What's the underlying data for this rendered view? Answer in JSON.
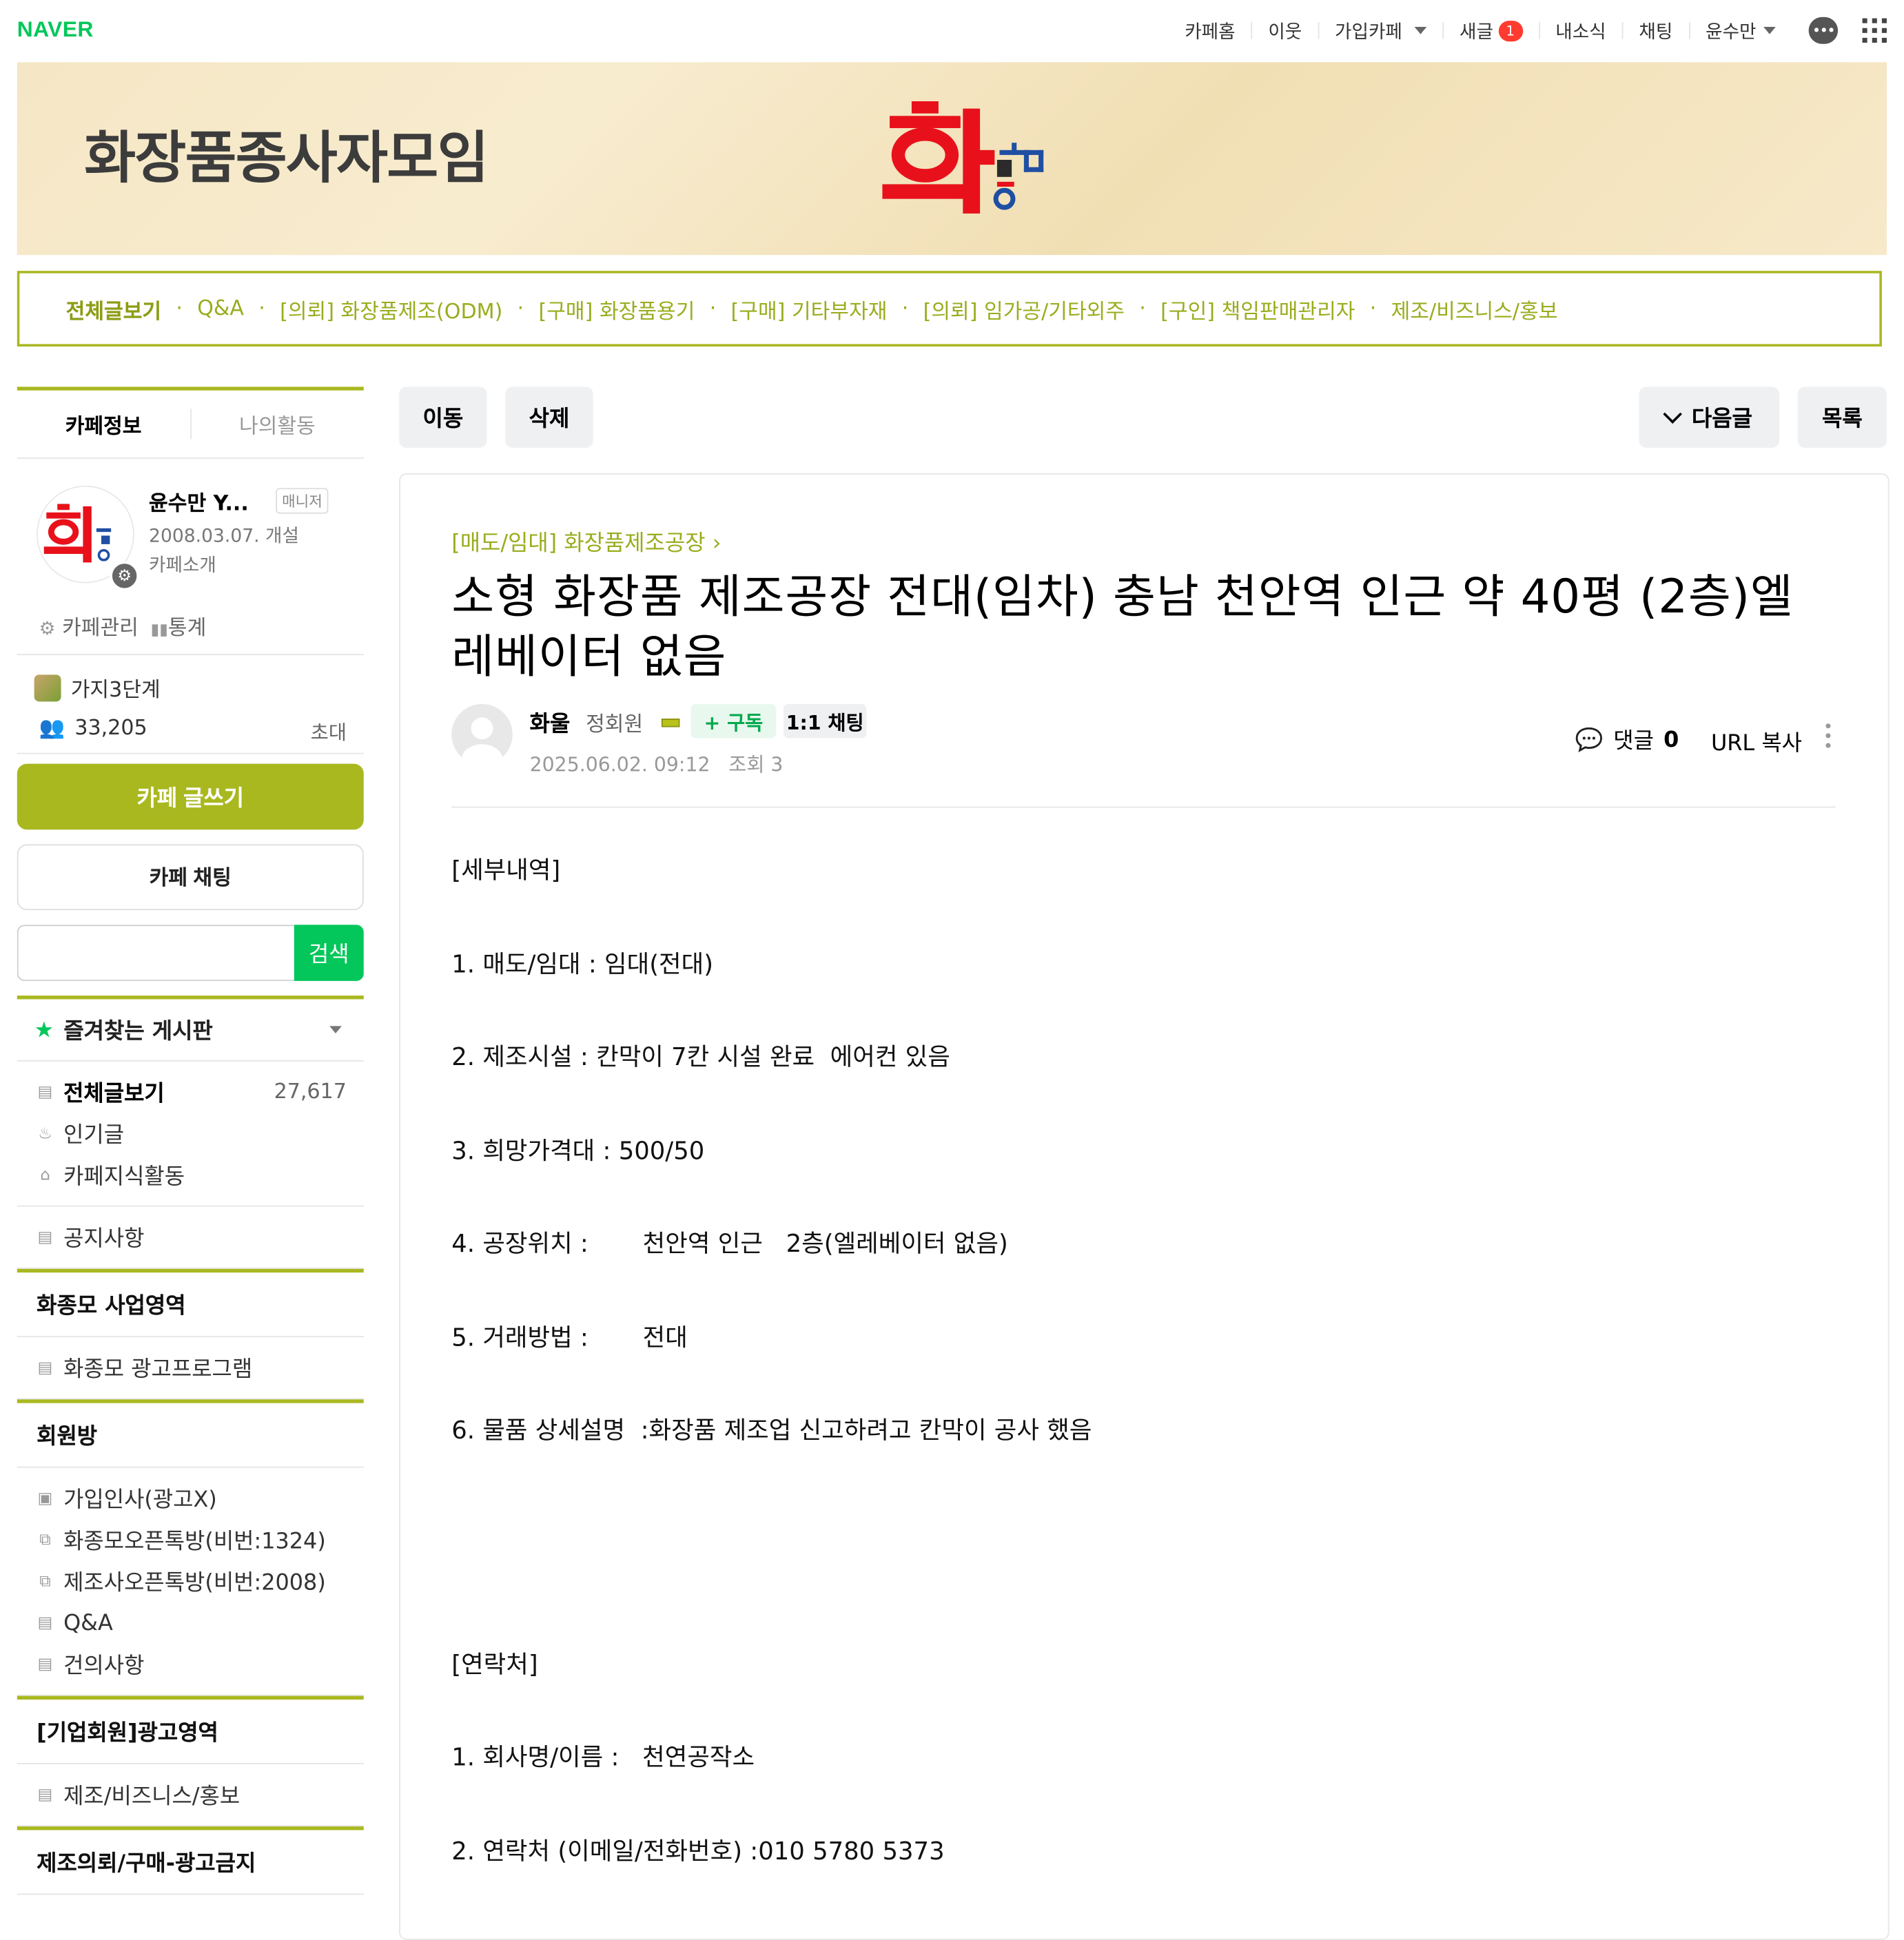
{
  "gnb": {
    "logo": "NAVER",
    "items": [
      "카페홈",
      "이웃",
      "가입카페",
      "새글",
      "내소식",
      "채팅",
      "윤수만"
    ],
    "new_count": "1"
  },
  "banner": {
    "title": "화장품종사자모임"
  },
  "menu": [
    "전체글보기",
    "Q&A",
    "[의뢰] 화장품제조(ODM)",
    "[구매] 화장품용기",
    "[구매] 기타부자재",
    "[의뢰] 임가공/기타외주",
    "[구인] 책임판매관리자",
    "제조/비즈니스/홍보"
  ],
  "sidebar": {
    "tabs": [
      "카페정보",
      "나의활동"
    ],
    "manager_name": "윤수만 Y...",
    "manager_tag": "매니저",
    "open_date": "2008.03.07. 개설",
    "intro": "카페소개",
    "manage": "카페관리",
    "stats": "통계",
    "level": "가지3단계",
    "members": "33,205",
    "invite": "초대",
    "write_btn": "카페 글쓰기",
    "chat_btn": "카페 채팅",
    "search_btn": "검색",
    "fav_title": "즐겨찾는 게시판",
    "boards1": [
      {
        "label": "전체글보기",
        "count": "27,617"
      },
      {
        "label": "인기글"
      },
      {
        "label": "카페지식활동"
      }
    ],
    "notice": "공지사항",
    "sec1": "화종모 사업영역",
    "sec1_items": [
      "화종모 광고프로그램"
    ],
    "sec2": "회원방",
    "sec2_items": [
      "가입인사(광고X)",
      "화종모오픈톡방(비번:1324)",
      "제조사오픈톡방(비번:2008)",
      "Q&A",
      "건의사항"
    ],
    "sec3": "[기업회원]광고영역",
    "sec3_items": [
      "제조/비즈니스/홍보"
    ],
    "sec4": "제조의뢰/구매-광고금지"
  },
  "toolbar": {
    "move": "이동",
    "delete": "삭제",
    "next": "다음글",
    "list": "목록"
  },
  "article": {
    "board": "[매도/임대] 화장품제조공장",
    "title": "소형 화장품 제조공장 전대(임차) 충남 천안역 인근 약 40평 (2층)엘레베이터 없음",
    "author": "화울",
    "grade": "정회원",
    "subscribe": "+ 구독",
    "chat": "1:1 채팅",
    "date": "2025.06.02. 09:12",
    "views": "조회 3",
    "comments_label": "댓글",
    "comments_count": "0",
    "url_copy": "URL 복사",
    "lines": [
      "[세부내역]",
      "1. 매도/임대 : 임대(전대)",
      "2. 제조시설 : 칸막이 7칸 시설 완료  에어컨 있음",
      "3. 희망가격대 : 500/50",
      "4. 공장위치 :       천안역 인근   2층(엘레베이터 없음)",
      "5. 거래방법 :       전대",
      "6. 물품 상세설명  :화장품 제조업 신고하려고 칸막이 공사 했음",
      "[연락처]",
      "1. 회사명/이름 :   천연공작소",
      "2. 연락처 (이메일/전화번호) :010 5780 5373"
    ]
  },
  "colors": {
    "brand": "#03c75a",
    "cafe": "#a9b81f",
    "accent_red": "#e8111b"
  }
}
